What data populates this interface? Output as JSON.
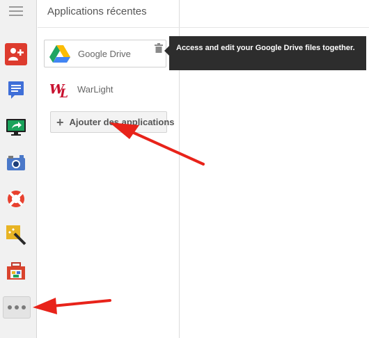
{
  "panel": {
    "title": "Applications récentes",
    "apps": [
      {
        "name": "Google Drive",
        "icon": "google-drive-icon"
      },
      {
        "name": "WarLight",
        "icon": "warlight-icon"
      }
    ],
    "add_button": "Ajouter des applications"
  },
  "tooltip": {
    "text": "Access and edit your Google Drive files together."
  },
  "rail": {
    "icons": [
      "add-person-icon",
      "document-icon",
      "screen-share-icon",
      "camera-icon",
      "lifebuoy-icon",
      "magic-wand-icon",
      "toolbox-icon"
    ],
    "more": "more-apps-icon"
  },
  "colors": {
    "accent_red": "#dd3b2e",
    "tooltip_bg": "#2d2d2d",
    "arrow_red": "#e8231a"
  }
}
